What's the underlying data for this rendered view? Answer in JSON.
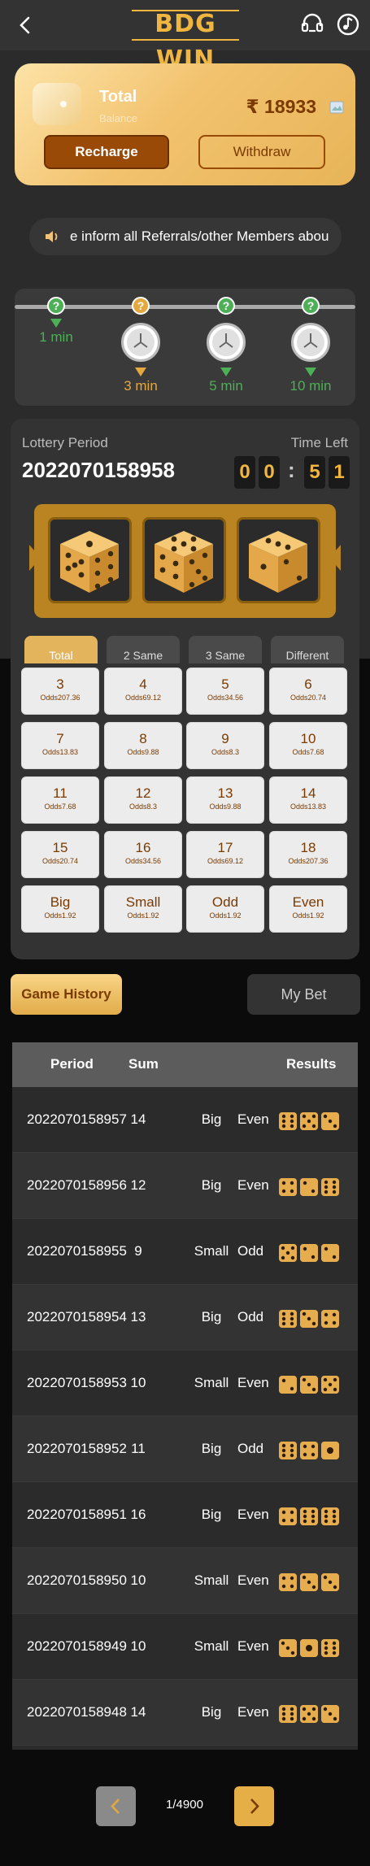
{
  "header": {
    "logo": "BDG WIN"
  },
  "wallet": {
    "title": "Total",
    "subtitle": "Balance",
    "amount": "₹ 18933",
    "recharge_label": "Recharge",
    "withdraw_label": "Withdraw"
  },
  "notice": {
    "text": "e inform all Referrals/other Members abou"
  },
  "modes": [
    {
      "label": "1 min",
      "q": "?"
    },
    {
      "label": "3 min",
      "q": "?"
    },
    {
      "label": "5 min",
      "q": "?"
    },
    {
      "label": "10 min",
      "q": "?"
    }
  ],
  "game": {
    "period_label": "Lottery Period",
    "period_value": "2022070158958",
    "time_label": "Time Left",
    "time_digits": [
      "0",
      "0",
      "5",
      "1"
    ],
    "time_colon": ":"
  },
  "tabs": [
    "Total",
    "2 Same",
    "3 Same",
    "Different"
  ],
  "bets": [
    {
      "value": "3",
      "odds": "Odds207.36"
    },
    {
      "value": "4",
      "odds": "Odds69.12"
    },
    {
      "value": "5",
      "odds": "Odds34.56"
    },
    {
      "value": "6",
      "odds": "Odds20.74"
    },
    {
      "value": "7",
      "odds": "Odds13.83"
    },
    {
      "value": "8",
      "odds": "Odds9.88"
    },
    {
      "value": "9",
      "odds": "Odds8.3"
    },
    {
      "value": "10",
      "odds": "Odds7.68"
    },
    {
      "value": "11",
      "odds": "Odds7.68"
    },
    {
      "value": "12",
      "odds": "Odds8.3"
    },
    {
      "value": "13",
      "odds": "Odds9.88"
    },
    {
      "value": "14",
      "odds": "Odds13.83"
    },
    {
      "value": "15",
      "odds": "Odds20.74"
    },
    {
      "value": "16",
      "odds": "Odds34.56"
    },
    {
      "value": "17",
      "odds": "Odds69.12"
    },
    {
      "value": "18",
      "odds": "Odds207.36"
    },
    {
      "value": "Big",
      "odds": "Odds1.92"
    },
    {
      "value": "Small",
      "odds": "Odds1.92"
    },
    {
      "value": "Odd",
      "odds": "Odds1.92"
    },
    {
      "value": "Even",
      "odds": "Odds1.92"
    }
  ],
  "buttons": {
    "game_history": "Game History",
    "my_bet": "My Bet"
  },
  "history": {
    "headers": {
      "period": "Period",
      "sum": "Sum",
      "results": "Results"
    },
    "rows": [
      {
        "period": "2022070158957",
        "sum": "14",
        "size": "Big",
        "parity": "Even",
        "dice": [
          6,
          5,
          3
        ]
      },
      {
        "period": "2022070158956",
        "sum": "12",
        "size": "Big",
        "parity": "Even",
        "dice": [
          4,
          2,
          6
        ]
      },
      {
        "period": "2022070158955",
        "sum": "9",
        "size": "Small",
        "parity": "Odd",
        "dice": [
          5,
          2,
          2
        ]
      },
      {
        "period": "2022070158954",
        "sum": "13",
        "size": "Big",
        "parity": "Odd",
        "dice": [
          6,
          3,
          4
        ]
      },
      {
        "period": "2022070158953",
        "sum": "10",
        "size": "Small",
        "parity": "Even",
        "dice": [
          2,
          3,
          5
        ]
      },
      {
        "period": "2022070158952",
        "sum": "11",
        "size": "Big",
        "parity": "Odd",
        "dice": [
          6,
          4,
          1
        ]
      },
      {
        "period": "2022070158951",
        "sum": "16",
        "size": "Big",
        "parity": "Even",
        "dice": [
          4,
          6,
          6
        ]
      },
      {
        "period": "2022070158950",
        "sum": "10",
        "size": "Small",
        "parity": "Even",
        "dice": [
          4,
          3,
          3
        ]
      },
      {
        "period": "2022070158949",
        "sum": "10",
        "size": "Small",
        "parity": "Even",
        "dice": [
          3,
          1,
          6
        ]
      },
      {
        "period": "2022070158948",
        "sum": "14",
        "size": "Big",
        "parity": "Even",
        "dice": [
          6,
          5,
          3
        ]
      }
    ]
  },
  "pagination": {
    "text": "1/4900"
  },
  "colors": {
    "gold": "#f0b640",
    "green": "#4db056",
    "brown": "#7a3a00",
    "dice": "#e6ad4f"
  }
}
